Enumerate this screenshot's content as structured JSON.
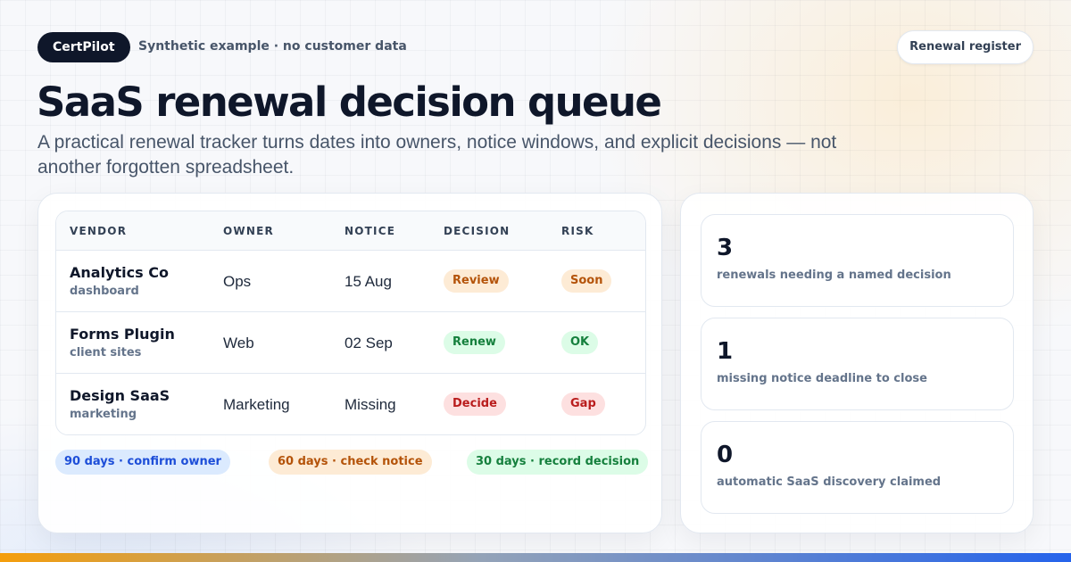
{
  "header": {
    "brand": "CertPilot",
    "note": "Synthetic example · no customer data",
    "register_button": "Renewal register"
  },
  "title": "SaaS renewal decision queue",
  "subtitle": "A practical renewal tracker turns dates into owners, notice windows, and explicit decisions — not another forgotten spreadsheet.",
  "table": {
    "columns": [
      "VENDOR",
      "OWNER",
      "NOTICE",
      "DECISION",
      "RISK"
    ],
    "rows": [
      {
        "vendor": "Analytics Co",
        "scope": "dashboard",
        "owner": "Ops",
        "notice": "15 Aug",
        "decision": "Review",
        "risk": "Soon"
      },
      {
        "vendor": "Forms Plugin",
        "scope": "client sites",
        "owner": "Web",
        "notice": "02 Sep",
        "decision": "Renew",
        "risk": "OK"
      },
      {
        "vendor": "Design SaaS",
        "scope": "marketing",
        "owner": "Marketing",
        "notice": "Missing",
        "decision": "Decide",
        "risk": "Gap"
      }
    ]
  },
  "timeline": [
    {
      "label": "90 days · confirm owner",
      "tone": "blue"
    },
    {
      "label": "60 days · check notice",
      "tone": "amber"
    },
    {
      "label": "30 days · record decision",
      "tone": "green"
    }
  ],
  "stats": [
    {
      "value": "3",
      "label": "renewals needing a named decision"
    },
    {
      "value": "1",
      "label": "missing notice deadline to close"
    },
    {
      "value": "0",
      "label": "automatic SaaS discovery claimed"
    }
  ],
  "colors": {
    "brand_dark": "#0f172a",
    "amber": "#b45309",
    "green": "#15803d",
    "red": "#b91c1c",
    "blue": "#1d4ed8"
  }
}
